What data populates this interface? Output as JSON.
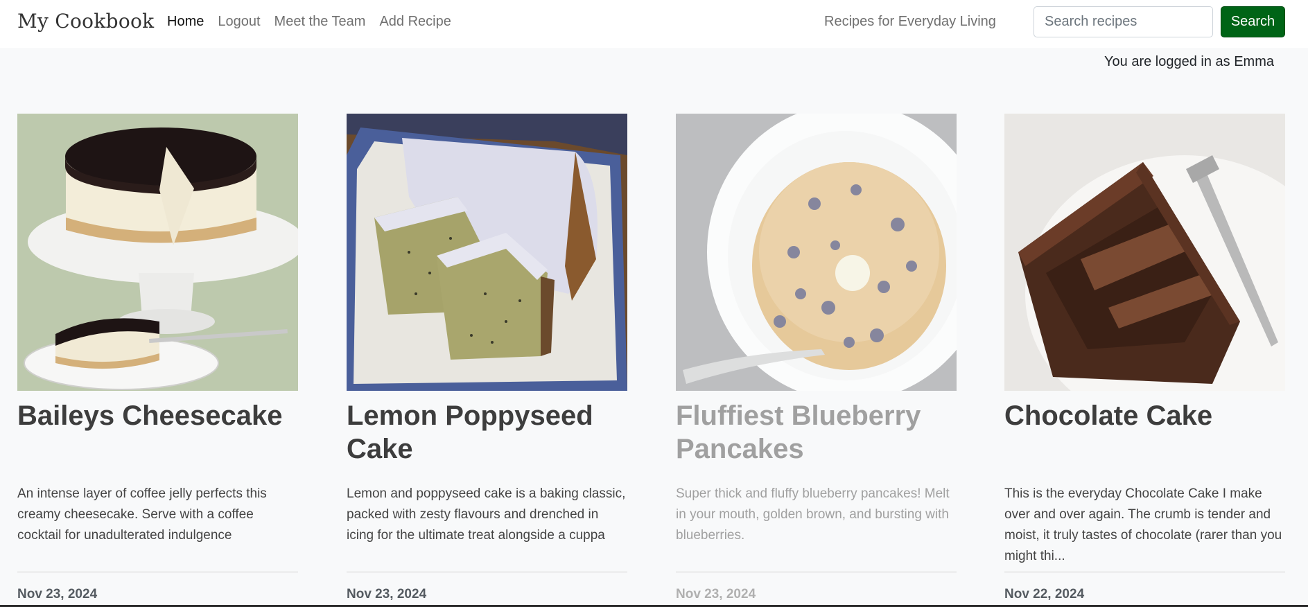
{
  "navbar": {
    "brand": "My Cookbook",
    "links": [
      {
        "label": "Home",
        "active": true
      },
      {
        "label": "Logout",
        "active": false
      },
      {
        "label": "Meet the Team",
        "active": false
      },
      {
        "label": "Add Recipe",
        "active": false
      }
    ],
    "tagline": "Recipes for Everyday Living",
    "search_placeholder": "Search recipes",
    "search_button": "Search",
    "search_button_color": "#006416"
  },
  "login_status": "You are logged in as Emma",
  "recipes": [
    {
      "title": "Baileys Cheesecake",
      "description": "An intense layer of coffee jelly perfects this creamy cheesecake. Serve with a coffee cocktail for unadulterated indulgence",
      "date": "Nov 23, 2024",
      "image_icon": "cheesecake-photo"
    },
    {
      "title": "Lemon Poppyseed Cake",
      "description": "Lemon and poppyseed cake is a baking classic, packed with zesty flavours and drenched in icing for the ultimate treat alongside a cuppa",
      "date": "Nov 23, 2024",
      "image_icon": "lemon-cake-photo"
    },
    {
      "title": "Fluffiest Blueberry Pancakes",
      "description": "Super thick and fluffy blueberry pancakes! Melt in your mouth, golden brown, and bursting with blueberries.",
      "date": "Nov 23, 2024",
      "image_icon": "pancakes-photo"
    },
    {
      "title": "Chocolate Cake",
      "description": "This is the everyday Chocolate Cake I make over and over again. The crumb is tender and moist, it truly tastes of chocolate (rarer than you might thi...",
      "date": "Nov 22, 2024",
      "image_icon": "chocolate-cake-photo"
    }
  ]
}
